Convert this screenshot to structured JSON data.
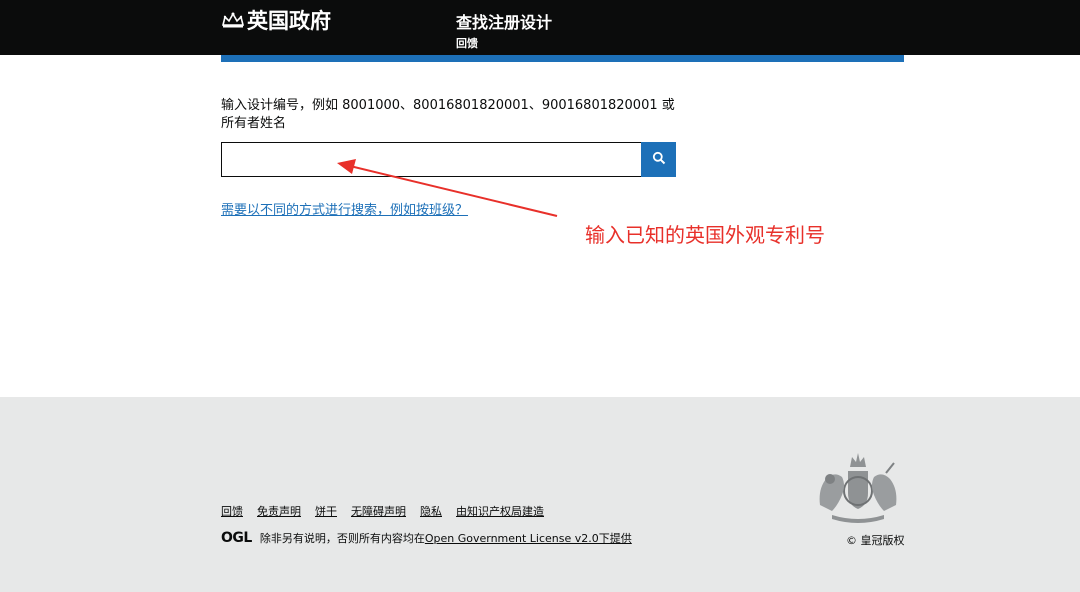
{
  "header": {
    "brand": "英国政府",
    "service_name": "查找注册设计",
    "service_link": "回馈"
  },
  "main": {
    "hint": "输入设计编号，例如 8001000、80016801820001、90016801820001 或所有者姓名",
    "search": {
      "value": "",
      "placeholder": ""
    },
    "alt_search_link": "需要以不同的方式进行搜索，例如按班级？",
    "annotation": "输入已知的英国外观专利号"
  },
  "footer": {
    "links": [
      "回馈",
      "免责声明",
      "饼干",
      "无障碍声明",
      "隐私",
      "由知识产权局建造"
    ],
    "ogl_logo": "OGL",
    "license_prefix": "除非另有说明，否则所有内容均在",
    "license_link": "Open Government License v2.0下提供",
    "copyright": "© 皇冠版权"
  },
  "colors": {
    "header_bg": "#0b0c0c",
    "accent_blue": "#1d70b8",
    "annotation_red": "#e8302a",
    "footer_bg": "#e7e8e8"
  },
  "icons": [
    "crown-icon",
    "search-icon",
    "royal-crest-icon"
  ]
}
